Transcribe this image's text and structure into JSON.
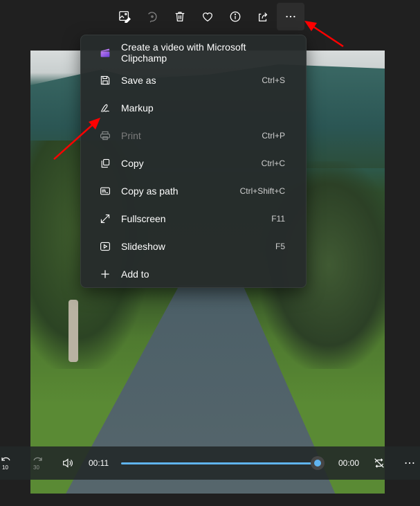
{
  "toolbar": {
    "buttons": [
      {
        "name": "edit-image",
        "label": "Edit image"
      },
      {
        "name": "rotate",
        "label": "Rotate",
        "disabled": true
      },
      {
        "name": "delete",
        "label": "Delete"
      },
      {
        "name": "favorite",
        "label": "Favorite"
      },
      {
        "name": "file-info",
        "label": "File info"
      },
      {
        "name": "share",
        "label": "Share"
      },
      {
        "name": "see-more",
        "label": "See more",
        "active": true
      }
    ]
  },
  "menu": {
    "items": [
      {
        "icon": "clipchamp-icon",
        "label": "Create a video with Microsoft Clipchamp",
        "shortcut": ""
      },
      {
        "icon": "save-icon",
        "label": "Save as",
        "shortcut": "Ctrl+S"
      },
      {
        "icon": "markup-pen-icon",
        "label": "Markup",
        "shortcut": ""
      },
      {
        "icon": "print-icon",
        "label": "Print",
        "shortcut": "Ctrl+P",
        "disabled": true
      },
      {
        "icon": "copy-icon",
        "label": "Copy",
        "shortcut": "Ctrl+C"
      },
      {
        "icon": "copy-path-icon",
        "label": "Copy as path",
        "shortcut": "Ctrl+Shift+C"
      },
      {
        "icon": "fullscreen-icon",
        "label": "Fullscreen",
        "shortcut": "F11"
      },
      {
        "icon": "slideshow-icon",
        "label": "Slideshow",
        "shortcut": "F5"
      },
      {
        "icon": "add-icon",
        "label": "Add to",
        "shortcut": ""
      }
    ]
  },
  "player": {
    "skip_back_seconds": "10",
    "skip_forward_seconds": "30",
    "current_time": "00:11",
    "remaining_time": "00:00",
    "progress_fraction": 0.99
  },
  "colors": {
    "accent": "#60b4f0",
    "clipchamp": "#8b5cf6",
    "annotation_arrow": "#ff0000"
  }
}
